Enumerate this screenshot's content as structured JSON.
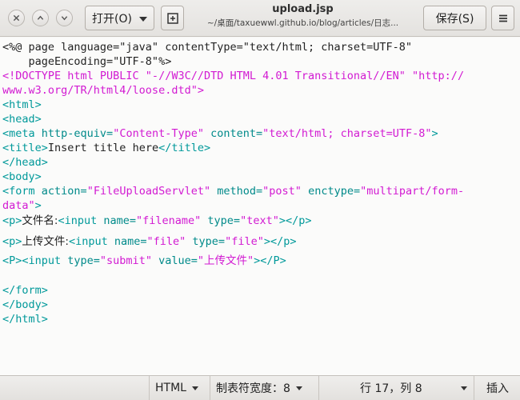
{
  "header": {
    "open_label": "打开(O)",
    "title": "upload.jsp",
    "path": "~/桌面/taxuewwl.github.io/blog/articles/日志...",
    "save_label": "保存(S)"
  },
  "editor": {
    "lines": [
      {
        "segs": [
          {
            "c": "txt",
            "t": "<%@ page language=\"java\" contentType=\"text/html; charset=UTF-8\""
          }
        ]
      },
      {
        "segs": [
          {
            "c": "txt",
            "t": "    pageEncoding=\"UTF-8\"%>"
          }
        ]
      },
      {
        "segs": [
          {
            "c": "doc",
            "t": "<!DOCTYPE html PUBLIC \"-//W3C//DTD HTML 4.01 Transitional//EN\" \"http://"
          }
        ]
      },
      {
        "segs": [
          {
            "c": "doc",
            "t": "www.w3.org/TR/html4/loose.dtd\">"
          }
        ]
      },
      {
        "segs": [
          {
            "c": "tag",
            "t": "<html>"
          }
        ]
      },
      {
        "segs": [
          {
            "c": "tag",
            "t": "<head>"
          }
        ]
      },
      {
        "segs": [
          {
            "c": "tag",
            "t": "<meta "
          },
          {
            "c": "attr",
            "t": "http-equiv="
          },
          {
            "c": "str",
            "t": "\"Content-Type\""
          },
          {
            "c": "attr",
            "t": " content="
          },
          {
            "c": "str",
            "t": "\"text/html; charset=UTF-8\""
          },
          {
            "c": "tag",
            "t": ">"
          }
        ]
      },
      {
        "segs": [
          {
            "c": "tag",
            "t": "<title>"
          },
          {
            "c": "txt",
            "t": "Insert title here"
          },
          {
            "c": "tag",
            "t": "</title>"
          }
        ]
      },
      {
        "segs": [
          {
            "c": "tag",
            "t": "</head>"
          }
        ]
      },
      {
        "segs": [
          {
            "c": "tag",
            "t": "<body>"
          }
        ]
      },
      {
        "segs": [
          {
            "c": "tag",
            "t": "<form "
          },
          {
            "c": "attr",
            "t": "action="
          },
          {
            "c": "str",
            "t": "\"FileUploadServlet\""
          },
          {
            "c": "attr",
            "t": " method="
          },
          {
            "c": "str",
            "t": "\"post\""
          },
          {
            "c": "attr",
            "t": " enctype="
          },
          {
            "c": "str",
            "t": "\"multipart/form-"
          }
        ]
      },
      {
        "segs": [
          {
            "c": "str",
            "t": "data\""
          },
          {
            "c": "tag",
            "t": ">"
          }
        ]
      },
      {
        "segs": [
          {
            "c": "tag",
            "t": "<p>"
          },
          {
            "c": "txt cjk",
            "t": "文件名:"
          },
          {
            "c": "tag",
            "t": "<input "
          },
          {
            "c": "attr",
            "t": "name="
          },
          {
            "c": "str",
            "t": "\"filename\""
          },
          {
            "c": "attr",
            "t": " type="
          },
          {
            "c": "str",
            "t": "\"text\""
          },
          {
            "c": "tag",
            "t": "></p>"
          }
        ]
      },
      {
        "segs": [
          {
            "c": "tag",
            "t": "<p>"
          },
          {
            "c": "txt cjk",
            "t": "上传文件:"
          },
          {
            "c": "tag",
            "t": "<input "
          },
          {
            "c": "attr",
            "t": "name="
          },
          {
            "c": "str",
            "t": "\"file\""
          },
          {
            "c": "attr",
            "t": " type="
          },
          {
            "c": "str",
            "t": "\"file\""
          },
          {
            "c": "tag",
            "t": "></p>"
          }
        ]
      },
      {
        "segs": [
          {
            "c": "tag",
            "t": "<P><input "
          },
          {
            "c": "attr",
            "t": "type="
          },
          {
            "c": "str",
            "t": "\"submit\""
          },
          {
            "c": "attr",
            "t": " value="
          },
          {
            "c": "str",
            "t": "\""
          },
          {
            "c": "str cjk",
            "t": "上传文件"
          },
          {
            "c": "str",
            "t": "\""
          },
          {
            "c": "tag",
            "t": "></P>"
          }
        ]
      },
      {
        "segs": [
          {
            "c": "txt",
            "t": ""
          }
        ]
      },
      {
        "segs": [
          {
            "c": "tag",
            "t": "</form>"
          }
        ]
      },
      {
        "segs": [
          {
            "c": "tag",
            "t": "</body>"
          }
        ]
      },
      {
        "segs": [
          {
            "c": "tag",
            "t": "</html>"
          }
        ]
      }
    ]
  },
  "status": {
    "language": "HTML",
    "tab_width": "制表符宽度：8",
    "position": "行 17，列 8",
    "mode": "插入"
  }
}
